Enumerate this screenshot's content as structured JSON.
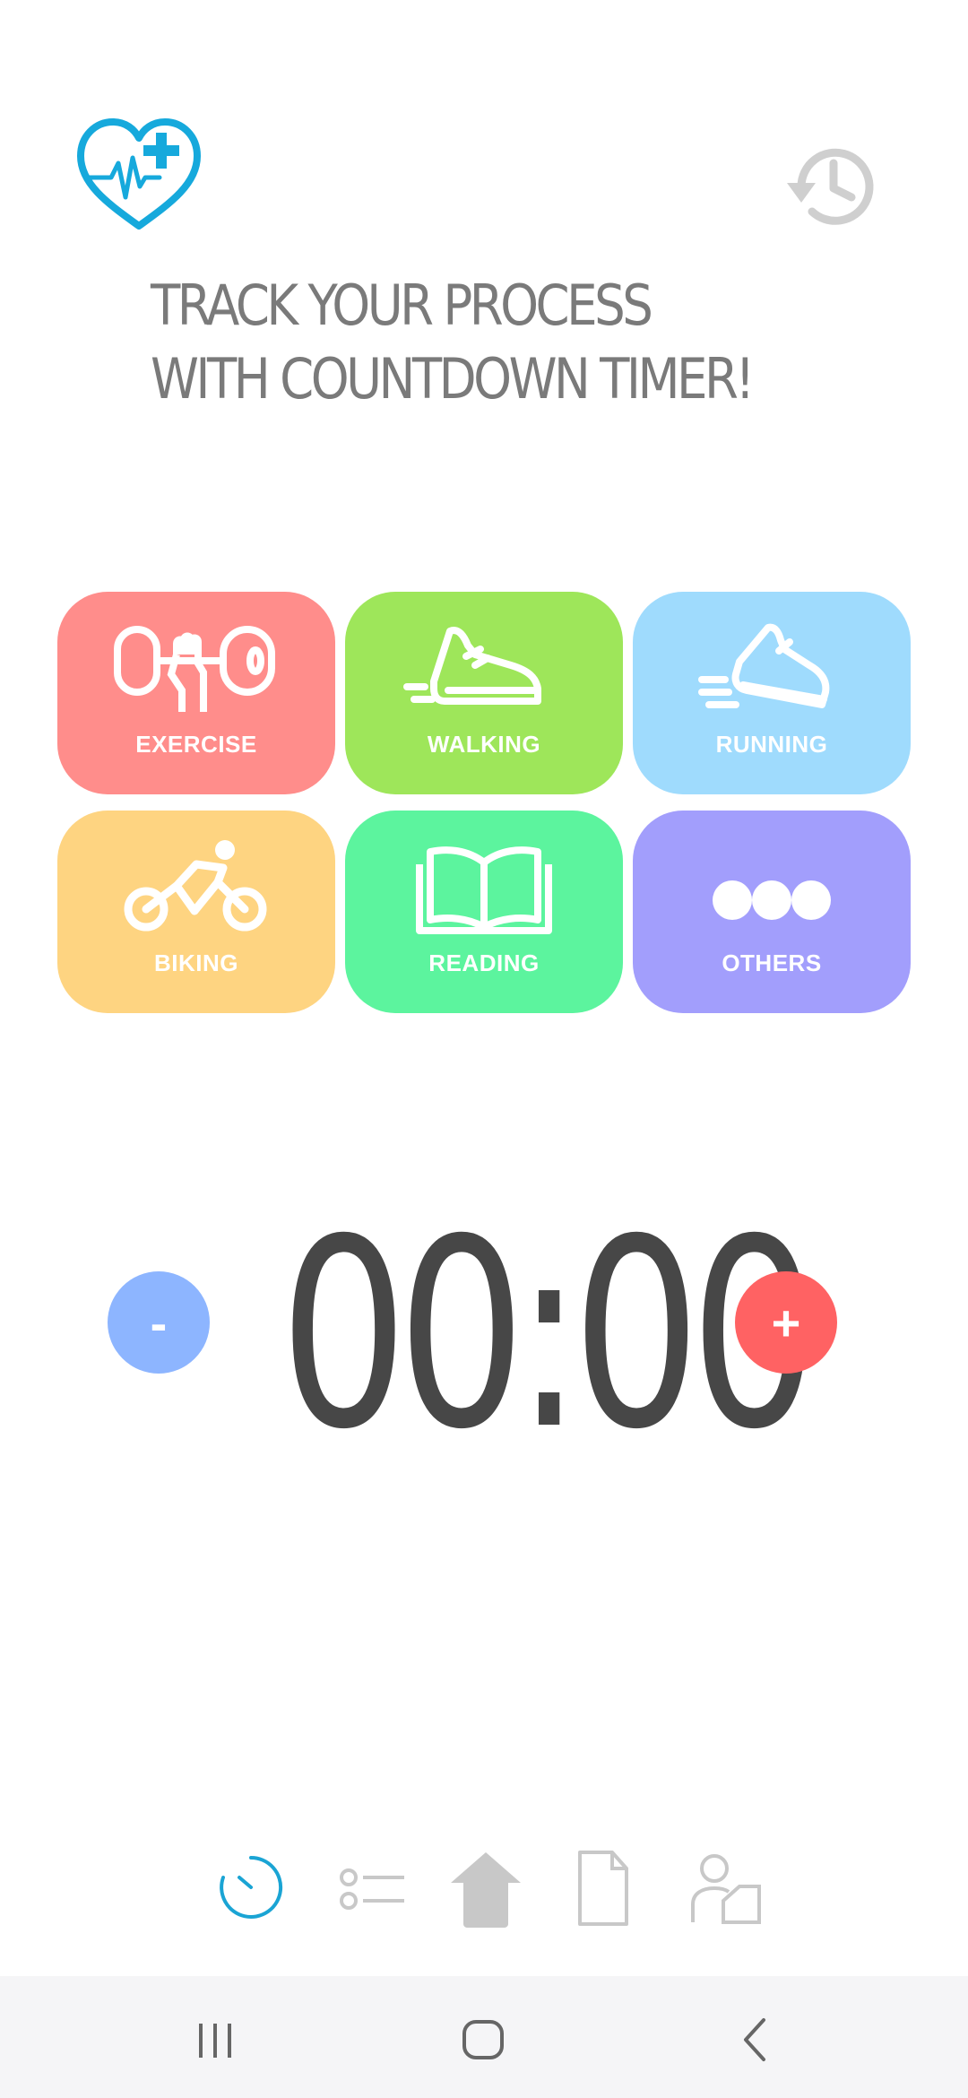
{
  "header": {
    "logo_icon": "heart-plus-pulse-icon",
    "history_icon": "history-icon",
    "headline_line1": "TRACK YOUR PROCESS",
    "headline_line2": "WITH COUNTDOWN TIMER!"
  },
  "activities": [
    {
      "label": "EXERCISE",
      "icon": "dumbbell-icon",
      "color": "#ff8d8b"
    },
    {
      "label": "WALKING",
      "icon": "sneaker-icon",
      "color": "#9ee65a"
    },
    {
      "label": "RUNNING",
      "icon": "running-shoe-icon",
      "color": "#9fdbfd"
    },
    {
      "label": "BIKING",
      "icon": "cyclist-icon",
      "color": "#fed481"
    },
    {
      "label": "READING",
      "icon": "open-book-icon",
      "color": "#5cf49e"
    },
    {
      "label": "OTHERS",
      "icon": "more-dots-icon",
      "color": "#a29efc"
    }
  ],
  "timer": {
    "display": "00:00",
    "decrement_label": "-",
    "increment_label": "+",
    "decrement_color": "#8db5ff",
    "increment_color": "#ff6263"
  },
  "bottom_nav": {
    "items": [
      {
        "icon": "timer-icon",
        "active": true
      },
      {
        "icon": "list-icon",
        "active": false
      },
      {
        "icon": "home-icon",
        "active": false
      },
      {
        "icon": "document-icon",
        "active": false
      },
      {
        "icon": "profile-icon",
        "active": false
      }
    ],
    "active_color": "#1aa4d4",
    "inactive_color": "#c8c8c8"
  },
  "system_nav": {
    "items": [
      "recent-apps-icon",
      "home-circle-icon",
      "back-icon"
    ]
  }
}
